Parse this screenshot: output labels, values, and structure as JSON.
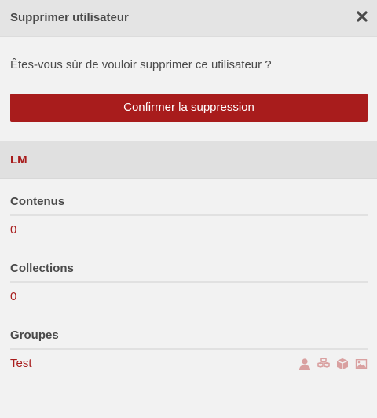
{
  "dialog": {
    "title": "Supprimer utilisateur",
    "close_icon": "close-icon",
    "confirm_question": "Êtes-vous sûr de vouloir supprimer ce utilisateur  ?",
    "confirm_button_label": "Confirmer la suppression"
  },
  "user": {
    "name": "LM"
  },
  "sections": {
    "contents": {
      "title": "Contenus",
      "value": "0"
    },
    "collections": {
      "title": "Collections",
      "value": "0"
    },
    "groups": {
      "title": "Groupes",
      "items": [
        {
          "name": "Test",
          "icons": [
            "user-icon",
            "cubes-icon",
            "cube-icon",
            "image-icon"
          ]
        }
      ]
    }
  },
  "colors": {
    "accent": "#a81c1c",
    "header_bg": "#e4e4e4",
    "body_bg": "#f2f2f2",
    "icon_muted": "#d9a0a0"
  }
}
